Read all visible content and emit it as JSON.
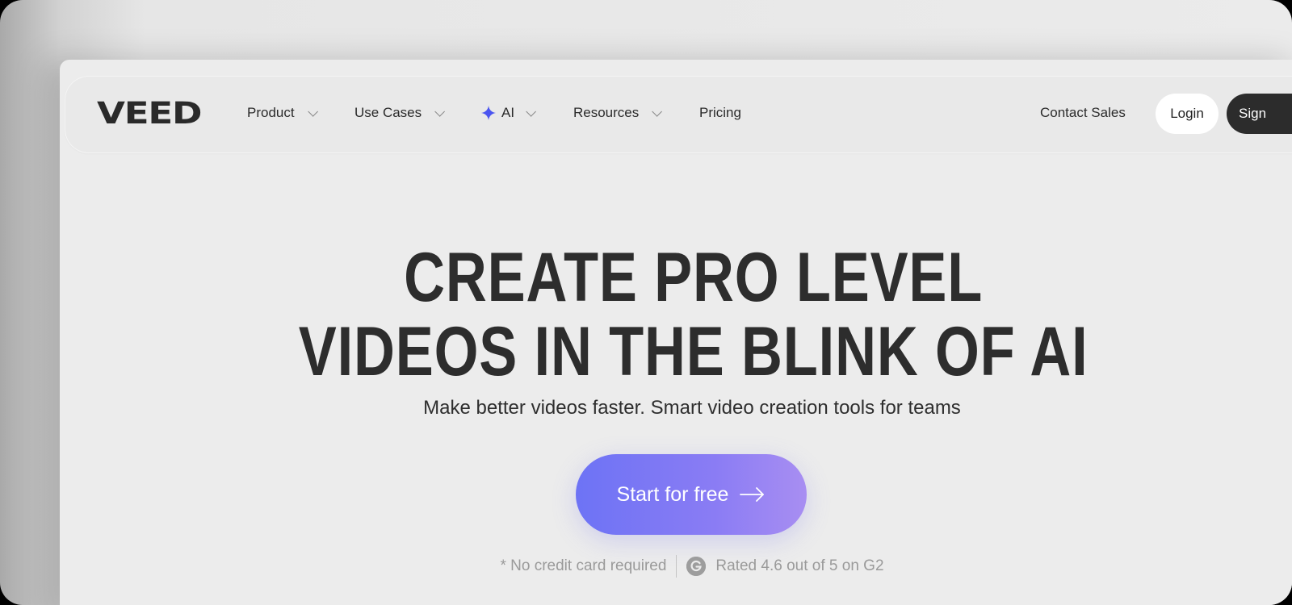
{
  "brand": {
    "logo_text": "VEED"
  },
  "nav": {
    "items": [
      {
        "label": "Product",
        "has_dropdown": true,
        "icon": "chevron-down-icon"
      },
      {
        "label": "Use Cases",
        "has_dropdown": true,
        "icon": "chevron-down-icon"
      },
      {
        "label": "AI",
        "has_dropdown": true,
        "icon": "sparkle-icon"
      },
      {
        "label": "Resources",
        "has_dropdown": true,
        "icon": "chevron-down-icon"
      },
      {
        "label": "Pricing",
        "has_dropdown": false
      }
    ],
    "contact_label": "Contact Sales",
    "login_label": "Login",
    "signup_label": "Sign"
  },
  "hero": {
    "title_line1": "CREATE PRO LEVEL",
    "title_line2": "VIDEOS IN THE BLINK OF AI",
    "subtitle": "Make better videos faster. Smart video creation tools for teams",
    "cta_label": "Start for free",
    "note": "* No credit card required",
    "rating": "Rated 4.6 out of 5 on G2"
  },
  "colors": {
    "accent_gradient_start": "#6d73f5",
    "accent_gradient_end": "#a88ef2",
    "ai_sparkle": "#4b55f0",
    "dark": "#2c2c2c"
  }
}
